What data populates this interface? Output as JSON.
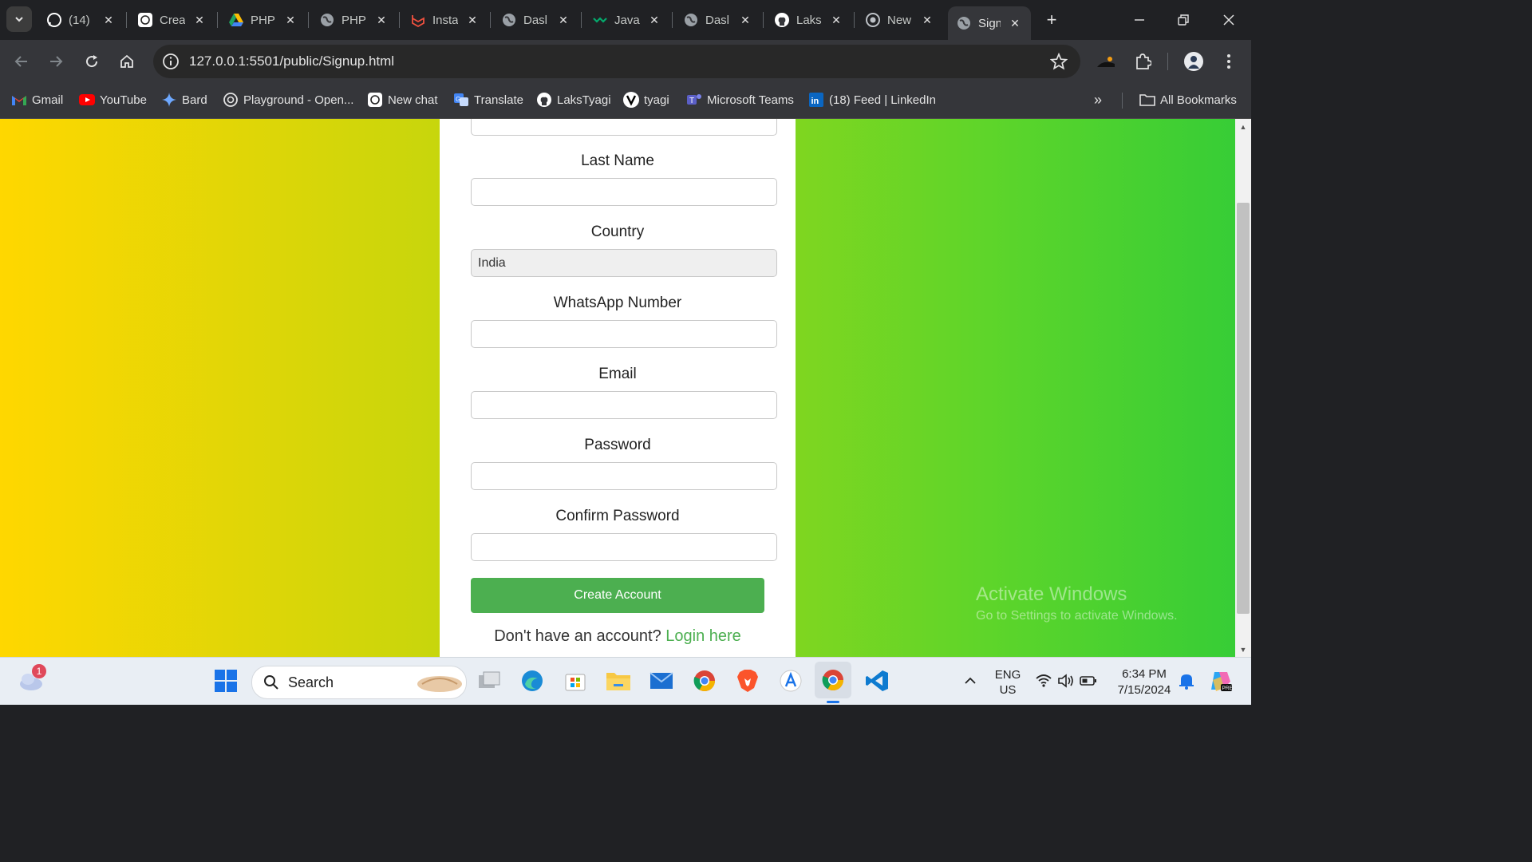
{
  "browser": {
    "tabs": [
      {
        "title": "(14)",
        "icon": "whatsapp-icon"
      },
      {
        "title": "Crea",
        "icon": "openai-icon"
      },
      {
        "title": "PHP",
        "icon": "google-drive-icon"
      },
      {
        "title": "PHP",
        "icon": "globe-icon"
      },
      {
        "title": "Insta",
        "icon": "laravel-icon"
      },
      {
        "title": "Dasl",
        "icon": "globe-icon"
      },
      {
        "title": "Java",
        "icon": "w3schools-icon"
      },
      {
        "title": "Dasl",
        "icon": "globe-icon"
      },
      {
        "title": "Laks",
        "icon": "github-icon"
      },
      {
        "title": "New",
        "icon": "openai-icon"
      },
      {
        "title": "Sign",
        "icon": "globe-icon",
        "active": true
      }
    ],
    "close_glyph": "✕",
    "new_tab_glyph": "+",
    "url": "127.0.0.1:5501/public/Signup.html",
    "bookmarks": [
      {
        "label": "Gmail",
        "icon": "gmail-icon"
      },
      {
        "label": "YouTube",
        "icon": "youtube-icon"
      },
      {
        "label": "Bard",
        "icon": "bard-icon"
      },
      {
        "label": "Playground - Open...",
        "icon": "openai-icon"
      },
      {
        "label": "New chat",
        "icon": "openai-icon"
      },
      {
        "label": "Translate",
        "icon": "translate-icon"
      },
      {
        "label": "LaksTyagi",
        "icon": "github-icon"
      },
      {
        "label": "tyagi",
        "icon": "v-icon"
      },
      {
        "label": "Microsoft Teams",
        "icon": "teams-icon"
      },
      {
        "label": "(18) Feed | LinkedIn",
        "icon": "linkedin-icon"
      }
    ],
    "all_bookmarks": "All Bookmarks",
    "overflow_glyph": "»"
  },
  "form": {
    "last_name_label": "Last Name",
    "country_label": "Country",
    "country_value": "India",
    "whatsapp_label": "WhatsApp Number",
    "email_label": "Email",
    "password_label": "Password",
    "confirm_password_label": "Confirm Password",
    "create_button": "Create Account",
    "footer_text": "Don't have an account?",
    "login_link": "Login here"
  },
  "watermark": {
    "line1": "Activate Windows",
    "line2": "Go to Settings to activate Windows."
  },
  "taskbar": {
    "search_label": "Search",
    "weather_badge": "1",
    "lang_line1": "ENG",
    "lang_line2": "US",
    "time": "6:34 PM",
    "date": "7/15/2024"
  },
  "colors": {
    "accent_green": "#4caf50",
    "gradient_left": "#FFD700",
    "gradient_right": "#32CD32"
  }
}
